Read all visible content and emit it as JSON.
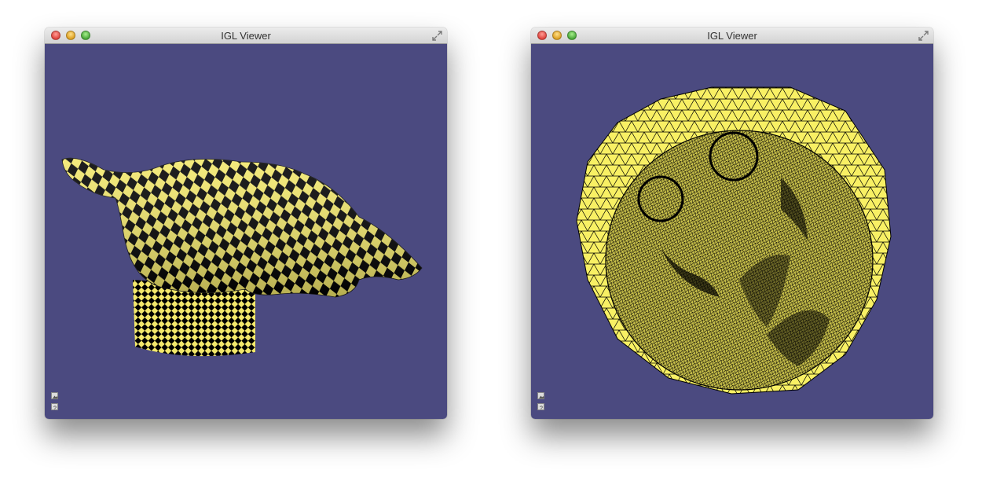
{
  "windows": [
    {
      "title": "IGL Viewer",
      "scene": "checkerboard textured 3D mesh",
      "background_color": "#4b4a80",
      "mesh_colors": [
        "#f3e86b",
        "#000000"
      ],
      "toolbar_icons": [
        "image-icon",
        "help-icon"
      ]
    },
    {
      "title": "IGL Viewer",
      "scene": "flattened parameterization wireframe mesh",
      "background_color": "#4b4a80",
      "mesh_colors": [
        "#f8f064",
        "#000000"
      ],
      "toolbar_icons": [
        "image-icon",
        "help-icon"
      ]
    }
  ]
}
